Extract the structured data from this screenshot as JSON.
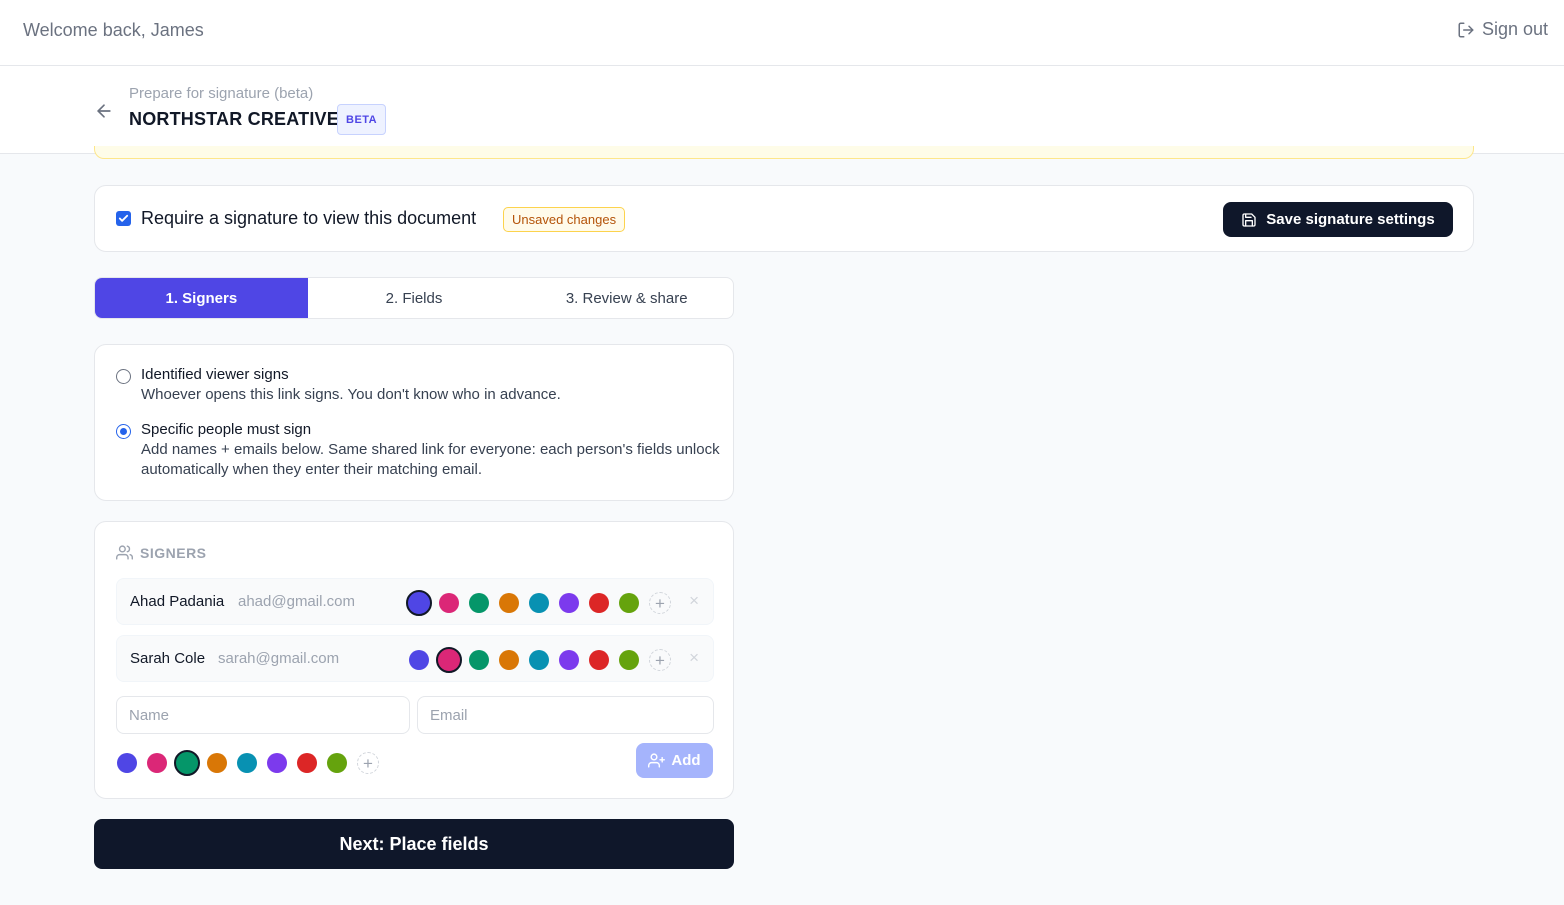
{
  "header": {
    "welcome": "Welcome back, James",
    "signout_label": "Sign out",
    "signout_icon": "log-out-icon"
  },
  "subheader": {
    "kicker": "Prepare for signature (beta)",
    "document_title": "NORTHSTAR CREATIVE",
    "badge": "BETA",
    "back_icon": "arrow-left-icon"
  },
  "require": {
    "checked": true,
    "label": "Require a signature to view this document",
    "status_badge": "Unsaved changes",
    "save_label": "Save signature settings",
    "save_icon": "save-icon"
  },
  "tabs": [
    {
      "label": "1. Signers",
      "active": true
    },
    {
      "label": "2. Fields",
      "active": false
    },
    {
      "label": "3. Review & share",
      "active": false
    }
  ],
  "signing_mode": {
    "options": [
      {
        "title": "Identified viewer signs",
        "description": "Whoever opens this link signs. You don't know who in advance.",
        "selected": false
      },
      {
        "title": "Specific people must sign",
        "description": "Add names + emails below. Same shared link for everyone: each person's fields unlock automatically when they enter their matching email.",
        "selected": true
      }
    ]
  },
  "signers": {
    "heading": "SIGNERS",
    "heading_icon": "users-icon",
    "palette": [
      "#4f46e5",
      "#db2777",
      "#059669",
      "#d97706",
      "#0891b2",
      "#7c3aed",
      "#dc2626",
      "#65a30d"
    ],
    "list": [
      {
        "name": "Ahad Padania",
        "email": "ahad@gmail.com",
        "selected_color_index": 0
      },
      {
        "name": "Sarah Cole",
        "email": "sarah@gmail.com",
        "selected_color_index": 1
      }
    ],
    "new_signer": {
      "name_placeholder": "Name",
      "email_placeholder": "Email",
      "selected_color_index": 2,
      "add_label": "Add",
      "add_icon": "user-plus-icon"
    },
    "add_color_symbol": "+",
    "remove_symbol": "×"
  },
  "next_label": "Next: Place fields"
}
